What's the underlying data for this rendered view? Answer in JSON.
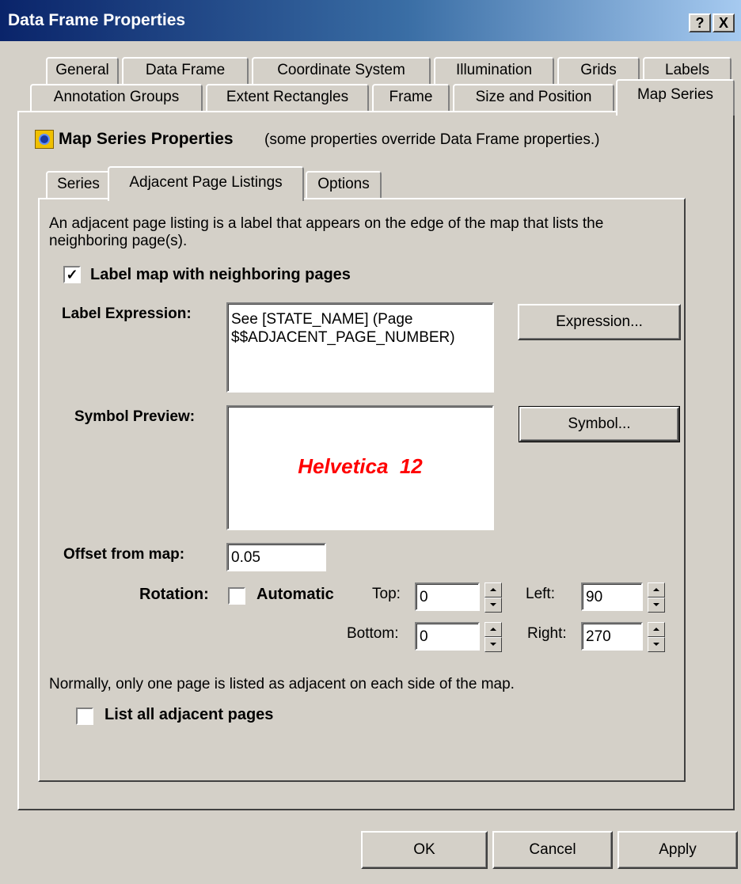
{
  "window": {
    "title": "Data Frame Properties",
    "help_label": "?",
    "close_label": "X"
  },
  "tabs_row1": [
    "General",
    "Data Frame",
    "Coordinate System",
    "Illumination",
    "Grids",
    "Labels"
  ],
  "tabs_row2": [
    "Annotation Groups",
    "Extent Rectangles",
    "Frame",
    "Size and Position",
    "Map Series"
  ],
  "header": {
    "title": "Map Series Properties",
    "note": "(some properties override Data Frame properties.)"
  },
  "subtabs": [
    "Series",
    "Adjacent Page Listings",
    "Options"
  ],
  "content": {
    "description": "An adjacent page listing is a label that appears on the edge of the map that lists the neighboring page(s).",
    "label_checkbox": "Label map with neighboring pages",
    "label_checked": true,
    "label_expression_label": "Label Expression:",
    "label_expression_value": "See [STATE_NAME] (Page $$ADJACENT_PAGE_NUMBER)",
    "expression_button": "Expression...",
    "symbol_preview_label": "Symbol Preview:",
    "symbol_preview_text": "Helvetica  12",
    "symbol_preview_color": "#ff0000",
    "symbol_button": "Symbol...",
    "offset_label": "Offset from map:",
    "offset_value": "0.05",
    "rotation_label": "Rotation:",
    "automatic_label": "Automatic",
    "automatic_checked": false,
    "top_label": "Top:",
    "top_value": "0",
    "bottom_label": "Bottom:",
    "bottom_value": "0",
    "left_label": "Left:",
    "left_value": "90",
    "right_label": "Right:",
    "right_value": "270",
    "normally_text": "Normally, only one page is listed as adjacent on each side of the map.",
    "list_all_label": "List all adjacent pages",
    "list_all_checked": false
  },
  "footer": {
    "ok": "OK",
    "cancel": "Cancel",
    "apply": "Apply"
  }
}
